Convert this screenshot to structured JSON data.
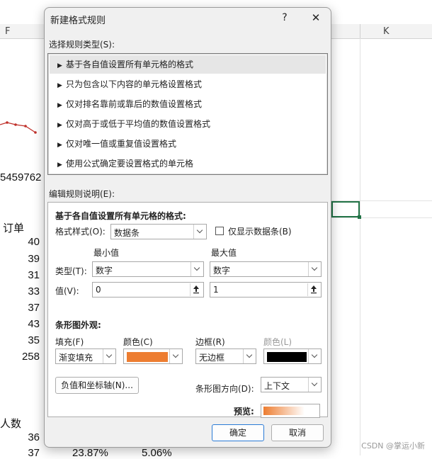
{
  "sheet": {
    "columns": [
      "F",
      "K"
    ],
    "cells_left": [
      "5459762",
      "订单",
      "40",
      "39",
      "31",
      "33",
      "37",
      "43",
      "35",
      "258",
      "人数",
      "36",
      "37"
    ],
    "cells_bottom": [
      "23.87%",
      "5.06%"
    ],
    "watermark": "CSDN @掌运小新"
  },
  "dialog": {
    "title": "新建格式规则",
    "help_label": "?",
    "close_label": "✕",
    "select_rule_type_label": "选择规则类型(S):",
    "rule_types": [
      "基于各自值设置所有单元格的格式",
      "只为包含以下内容的单元格设置格式",
      "仅对排名靠前或靠后的数值设置格式",
      "仅对高于或低于平均值的数值设置格式",
      "仅对唯一值或重复值设置格式",
      "使用公式确定要设置格式的单元格"
    ],
    "edit_rule_label": "编辑规则说明(E):",
    "section_title": "基于各自值设置所有单元格的格式:",
    "format_style_label": "格式样式(O):",
    "format_style_value": "数据条",
    "show_bar_only_label": "仅显示数据条(B)",
    "min_label": "最小值",
    "max_label": "最大值",
    "type_label": "类型(T):",
    "min_type_value": "数字",
    "max_type_value": "数字",
    "value_label": "值(V):",
    "min_value": "0",
    "max_value": "1",
    "bar_appearance_label": "条形图外观:",
    "fill_label": "填充(F)",
    "fill_color_label": "颜色(C)",
    "border_label": "边框(R)",
    "border_color_label": "颜色(L)",
    "fill_value": "渐变填充",
    "border_value": "无边框",
    "negative_axis_button": "负值和坐标轴(N)...",
    "bar_direction_label": "条形图方向(D):",
    "bar_direction_value": "上下文",
    "preview_label": "预览:",
    "ok_button": "确定",
    "cancel_button": "取消"
  },
  "colors": {
    "fill_color": "#ed7d31",
    "border_color": "#000000",
    "selection": "#217346"
  },
  "icons": {
    "ref_button": "upload-arrow-icon",
    "dropdown": "chevron-down-icon",
    "list_arrow": "triangle-right-icon"
  }
}
